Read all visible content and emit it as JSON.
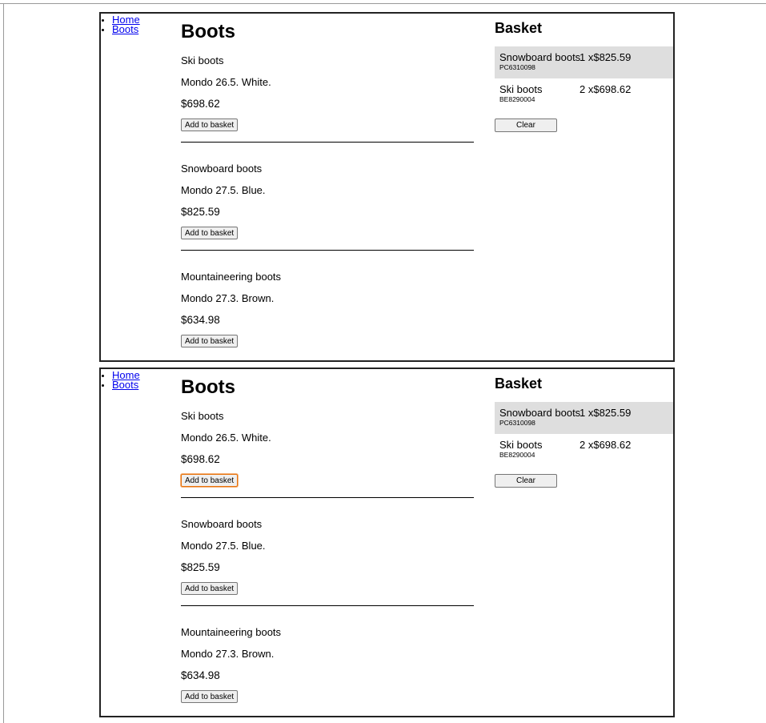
{
  "nav": {
    "items": [
      {
        "label": "Home"
      },
      {
        "label": "Boots"
      }
    ]
  },
  "page_title": "Boots",
  "products": [
    {
      "name": "Ski boots",
      "description": "Mondo 26.5. White.",
      "price": "$698.62",
      "button_label": "Add to basket"
    },
    {
      "name": "Snowboard boots",
      "description": "Mondo 27.5. Blue.",
      "price": "$825.59",
      "button_label": "Add to basket"
    },
    {
      "name": "Mountaineering boots",
      "description": "Mondo 27.3. Brown.",
      "price": "$634.98",
      "button_label": "Add to basket"
    }
  ],
  "basket": {
    "title": "Basket",
    "items": [
      {
        "name": "Snowboard boots",
        "code": "PC6310098",
        "quantity_price": "1 x$825.59"
      },
      {
        "name": "Ski boots",
        "code": "BE8290004",
        "quantity_price": "2 x$698.62"
      }
    ],
    "clear_label": "Clear",
    "row_highlight_color": "#dedede"
  },
  "focus_color": "#e8710a",
  "link_color": "#0000ee"
}
